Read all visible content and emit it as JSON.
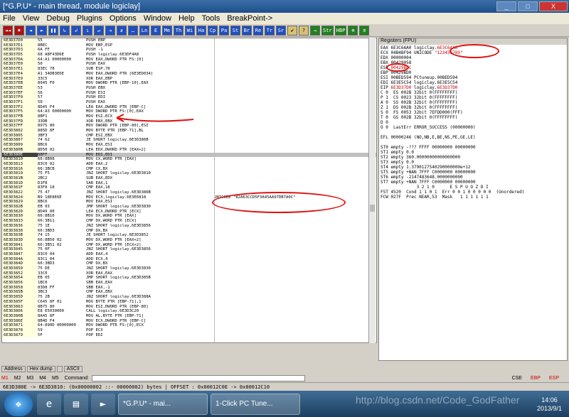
{
  "window": {
    "title": "[*G.P.U* - main thread, module logiclay]",
    "min": "_",
    "max": "□",
    "close": "X"
  },
  "menu": [
    "File",
    "View",
    "Debug",
    "Plugins",
    "Options",
    "Window",
    "Help",
    "Tools",
    "BreakPoint->"
  ],
  "toolbar_left": [
    "◄◄",
    "✖",
    "◄",
    "►",
    "❚❚",
    "↳",
    "↲",
    "↴",
    "↵",
    "⇥",
    "⇵",
    "…"
  ],
  "toolbar_letters": [
    "Ln",
    "E",
    "Me",
    "Th",
    "Wi",
    "Ha",
    "Cp",
    "Pa",
    "St",
    "Br",
    "Re",
    "Tr",
    "Sr"
  ],
  "toolbar_right": [
    "✔",
    "?",
    "→",
    "Str",
    "HBP",
    "⊕",
    "≡"
  ],
  "disasm": [
    [
      "6E3D37D0",
      "55",
      "PUSH EBP",
      ""
    ],
    [
      "6E3D37D1",
      "8BEC",
      "MOV EBP,ESP",
      ""
    ],
    [
      "6E3D37D3",
      "6A FF",
      "PUSH -1",
      ""
    ],
    [
      "6E3D37D5",
      "68 A8F43D6E",
      "PUSH logiclay.6E3DF4A8",
      ""
    ],
    [
      "6E3D37DA",
      "64:A1 00000000",
      "MOV EAX,DWORD PTR FS:[0]",
      ""
    ],
    [
      "6E3D37E0",
      "50",
      "PUSH EAX",
      ""
    ],
    [
      "6E3D37E1",
      "83EC 78",
      "SUB ESP,78",
      ""
    ],
    [
      "6E3D37E4",
      "A1 34DB3E6E",
      "MOV EAX,DWORD PTR [6E3ED034]",
      ""
    ],
    [
      "6E3D37E9",
      "33C5",
      "XOR EAX,EBP",
      ""
    ],
    [
      "6E3D37EB",
      "8945 F0",
      "MOV DWORD PTR [EBP-10],EAX",
      ""
    ],
    [
      "6E3D37EE",
      "53",
      "PUSH EBX",
      ""
    ],
    [
      "6E3D37EF",
      "56",
      "PUSH ESI",
      ""
    ],
    [
      "6E3D37F0",
      "57",
      "PUSH EDI",
      ""
    ],
    [
      "6E3D37F1",
      "50",
      "PUSH EAX",
      ""
    ],
    [
      "6E3D37F2",
      "8D45 F4",
      "LEA EAX,DWORD PTR [EBP-C]",
      ""
    ],
    [
      "6E3D37F5",
      "64:A3 00000000",
      "MOV DWORD PTR FS:[0],EAX",
      ""
    ],
    [
      "6E3D37FB",
      "8BF1",
      "MOV ESI,ECX",
      ""
    ],
    [
      "6E3D37FD",
      "33DB",
      "XOR EBX,EBX",
      ""
    ],
    [
      "6E3D37FF",
      "8975 80",
      "MOV DWORD PTR [EBP-80],ESI",
      ""
    ],
    [
      "6E3D3802",
      "885D 8F",
      "MOV BYTE PTR [EBP-71],BL",
      ""
    ],
    [
      "6E3D3805",
      "3BF3",
      "CMP ESI,EBX",
      ""
    ],
    [
      "6E3D3807",
      "74 62",
      "JE SHORT logiclay.6E3D386B",
      ""
    ],
    [
      "6E3D3809",
      "8BC6",
      "MOV EAX,ESI",
      ""
    ],
    [
      "6E3D380B",
      "8D50 02",
      "LEA EDX,DWORD PTR [EAX+2]",
      ""
    ],
    [
      "6E3D380E",
      "8BFF",
      "MOV EDI,EDI",
      ""
    ],
    [
      "6E3D3810",
      "66:8B08",
      "MOV CX,WORD PTR [EAX]",
      ""
    ],
    [
      "6E3D3813",
      "83C0 02",
      "ADD EAX,2",
      ""
    ],
    [
      "6E3D3816",
      "66:3BCB",
      "CMP CX,BX",
      ""
    ],
    [
      "6E3D3819",
      "75 F5",
      "JNZ SHORT logiclay.6E3D3810",
      ""
    ],
    [
      "6E3D381B",
      "2BC2",
      "SUB EAX,EDX",
      ""
    ],
    [
      "6E3D381D",
      "D1F8",
      "SAR EAX,1",
      ""
    ],
    [
      "6E3D381F",
      "83F8 18",
      "CMP EAX,18",
      ""
    ],
    [
      "6E3D3822",
      "75 47",
      "JNZ SHORT logiclay.6E3D386B",
      ""
    ],
    [
      "6E3D3824",
      "B9 18E8E6E",
      "MOV ECX,logiclay.6E3E6818",
      "UNICODE \"82A63CCD5F3A45AA97DB7A0C\""
    ],
    [
      "6E3D3829",
      "8BC6",
      "MOV EAX,ESI",
      ""
    ],
    [
      "6E3D382B",
      "EB 03",
      "JMP SHORT logiclay.6E3D3830",
      ""
    ],
    [
      "6E3D382D",
      "8D49 00",
      "LEA ECX,DWORD PTR [ECX]",
      ""
    ],
    [
      "6E3D3830",
      "66:8B10",
      "MOV DX,WORD PTR [EAX]",
      ""
    ],
    [
      "6E3D3833",
      "66:3B11",
      "CMP DX,WORD PTR [ECX]",
      ""
    ],
    [
      "6E3D3836",
      "75 1E",
      "JNZ SHORT logiclay.6E3D3856",
      ""
    ],
    [
      "6E3D3838",
      "66:3BD3",
      "CMP DX,BX",
      ""
    ],
    [
      "6E3D383B",
      "74 15",
      "JE SHORT logiclay.6E3D3852",
      ""
    ],
    [
      "6E3D383D",
      "66:8B50 02",
      "MOV DX,WORD PTR [EAX+2]",
      ""
    ],
    [
      "6E3D3841",
      "66:3B51 02",
      "CMP DX,WORD PTR [ECX+2]",
      ""
    ],
    [
      "6E3D3845",
      "75 0F",
      "JNZ SHORT logiclay.6E3D3856",
      ""
    ],
    [
      "6E3D3847",
      "83C0 04",
      "ADD EAX,4",
      ""
    ],
    [
      "6E3D384A",
      "83C1 04",
      "ADD ECX,4",
      ""
    ],
    [
      "6E3D384D",
      "66:3BD3",
      "CMP DX,BX",
      ""
    ],
    [
      "6E3D3850",
      "75 DE",
      "JNZ SHORT logiclay.6E3D3830",
      ""
    ],
    [
      "6E3D3852",
      "33C0",
      "XOR EAX,EAX",
      ""
    ],
    [
      "6E3D3854",
      "EB 05",
      "JMP SHORT logiclay.6E3D385B",
      ""
    ],
    [
      "6E3D3856",
      "1BC0",
      "SBB EAX,EAX",
      ""
    ],
    [
      "6E3D3858",
      "83D8 FF",
      "SBB EAX,-1",
      ""
    ],
    [
      "6E3D385B",
      "3BC3",
      "CMP EAX,EBX",
      ""
    ],
    [
      "6E3D385D",
      "75 2B",
      "JNZ SHORT logiclay.6E3D388A",
      ""
    ],
    [
      "6E3D385F",
      "C645 8F 01",
      "MOV BYTE PTR [EBP-71],1",
      ""
    ],
    [
      "6E3D3863",
      "8B75 80",
      "MOV ESI,DWORD PTR [EBP-80]",
      ""
    ],
    [
      "6E3D3866",
      "E8 E5030000",
      "CALL logiclay.6E3D3C20",
      ""
    ],
    [
      "6E3D386B",
      "8A45 8F",
      "MOV AL,BYTE PTR [EBP-71]",
      ""
    ],
    [
      "6E3D386E",
      "8B4D F4",
      "MOV ECX,DWORD PTR [EBP-C]",
      ""
    ],
    [
      "6E3D3871",
      "64:890D 00000000",
      "MOV DWORD PTR FS:[0],ECX",
      ""
    ],
    [
      "6E3D3878",
      "59",
      "POP ECX",
      ""
    ],
    [
      "6E3D3879",
      "5F",
      "POP EDI",
      ""
    ]
  ],
  "selected_row": 24,
  "registers": {
    "header": "Registers (FPU)",
    "lines": [
      [
        "EAX",
        "6E3C6AA0",
        "logiclay.",
        "6E3C6AA0"
      ],
      [
        "ECX",
        "04B4BF94",
        "UNICODE ",
        "\"123456789\""
      ],
      [
        "EDX",
        "00000004",
        "",
        ""
      ],
      [
        "EBX",
        "00429058",
        "",
        ""
      ],
      [
        "ESP",
        "00429BDC",
        "",
        ""
      ],
      [
        "EBP",
        "00429BD0",
        "",
        ""
      ],
      [
        "ESI",
        "00BED594",
        "PCtuneup.00BED594",
        ""
      ],
      [
        "EDI",
        "6E3E5C54",
        "logiclay.6E3E5C54",
        ""
      ],
      [
        "",
        "",
        " ",
        ""
      ],
      [
        "EIP",
        "6E3D37D0",
        "logiclay.",
        "6E3D37D0"
      ]
    ],
    "flags": [
      "C 0  ES 002B 32bit 0(FFFFFFFF)",
      "P 1  CS 0023 32bit 0(FFFFFFFF)",
      "A 0  SS 002B 32bit 0(FFFFFFFF)",
      "Z 1  DS 002B 32bit 0(FFFFFFFF)",
      "S 0  FS 0053 32bit 7EFDD000(FFF)",
      "T 0  GS 002B 32bit 0(FFFFFFFF)",
      "D 0",
      "O 0  LastErr ERROR_SUCCESS (00000000)",
      "",
      "EFL 00000246 (NO,NB,E,BE,NS,PE,GE,LE)",
      "",
      "ST0 empty -??? FFFF 00000000 00000000",
      "ST1 empty 0.0",
      "ST2 empty 360.00000000000000000",
      "ST3 empty 0.0",
      "ST4 empty 1.3790127540290000000e+12",
      "ST5 empty +NAN 7FFF C0000000 00000000",
      "ST6 empty -2147483648.0000000000",
      "ST7 empty +NAN 7FFF C0000000 00000000",
      "              3 2 1 0      E S P U O Z D I",
      "FST 4520  Cond 1 1 0 1  Err 0 0 1 0 0 0 0 0  (Unordered)",
      "FCW 027F  Prec NEAR,53  Mask   1 1 1 1 1 1"
    ]
  },
  "dump_tabs": [
    "Address",
    "Hex dump",
    "",
    "ASCII"
  ],
  "cmdbar": {
    "marks": [
      "M1",
      "M2",
      "M3",
      "M4",
      "M5"
    ],
    "label": "Command:",
    "right": [
      "CSE",
      "EBP",
      "ESP"
    ]
  },
  "status": "6E3D380E -> 6E3D3810: (0x00000002 ::- 00000002) bytes  | OFFSET : 0x00012C0E -> 0x00012C10",
  "taskbar": {
    "tasks": [
      "*G.P.U* - mai...",
      "1-Click PC Tune..."
    ],
    "time": "14:06",
    "date": "2013/9/1"
  },
  "watermark": "http://blog.csdn.net/Code_GodFather"
}
